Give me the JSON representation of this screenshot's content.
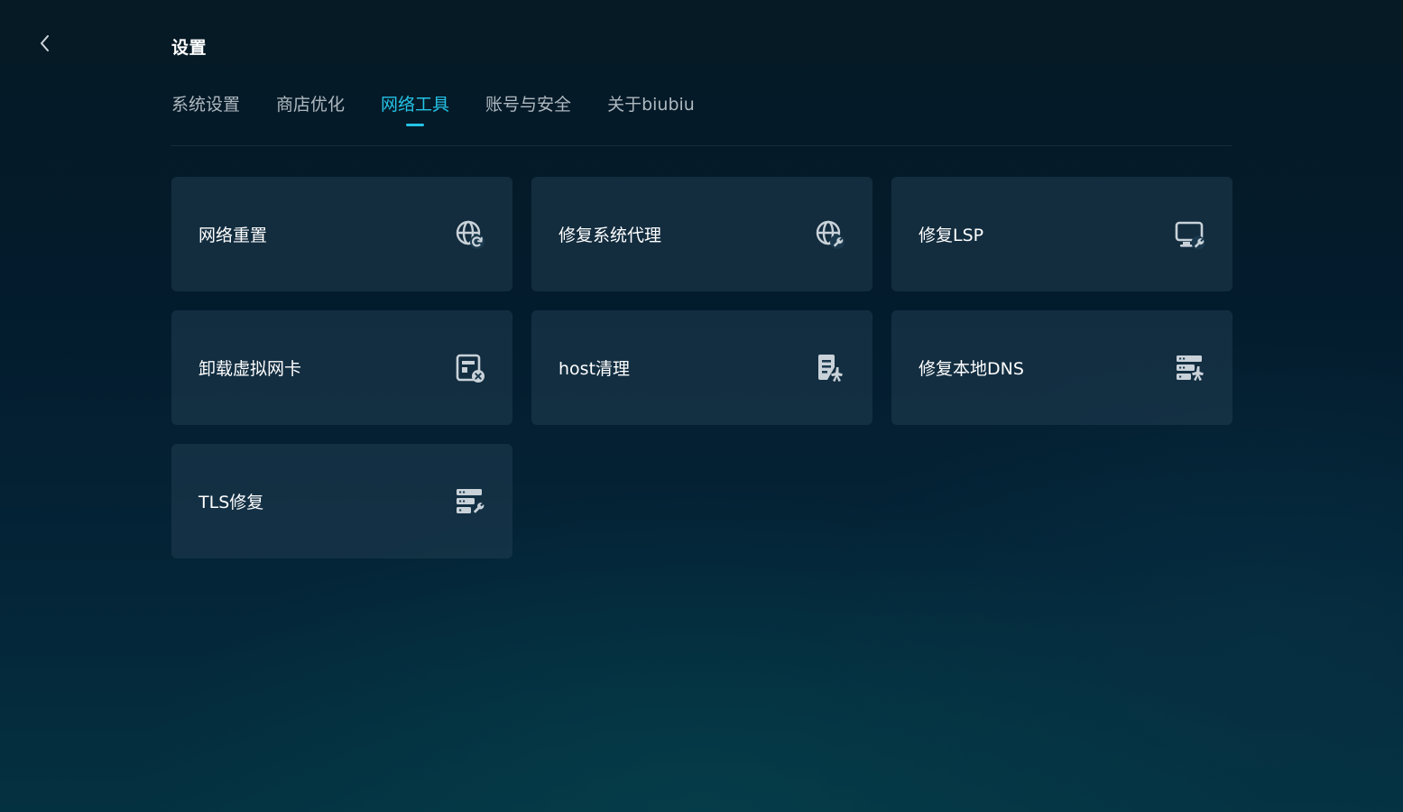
{
  "header": {
    "back_icon": "chevron-left-icon",
    "title": "设置"
  },
  "tabs": [
    {
      "label": "系统设置",
      "active": false
    },
    {
      "label": "商店优化",
      "active": false
    },
    {
      "label": "网络工具",
      "active": true
    },
    {
      "label": "账号与安全",
      "active": false
    },
    {
      "label": "关于biubiu",
      "active": false
    }
  ],
  "tools": [
    {
      "label": "网络重置",
      "icon": "globe-refresh-icon"
    },
    {
      "label": "修复系统代理",
      "icon": "globe-wrench-icon"
    },
    {
      "label": "修复LSP",
      "icon": "monitor-wrench-icon"
    },
    {
      "label": "卸载虚拟网卡",
      "icon": "network-card-remove-icon"
    },
    {
      "label": "host清理",
      "icon": "document-sweep-icon"
    },
    {
      "label": "修复本地DNS",
      "icon": "server-sweep-icon"
    },
    {
      "label": "TLS修复",
      "icon": "server-wrench-icon"
    }
  ],
  "colors": {
    "accent": "#25c3e6",
    "tab_inactive": "#aeb8c0",
    "card_bg": "#1c3a4e",
    "icon": "#c9d2d9"
  }
}
